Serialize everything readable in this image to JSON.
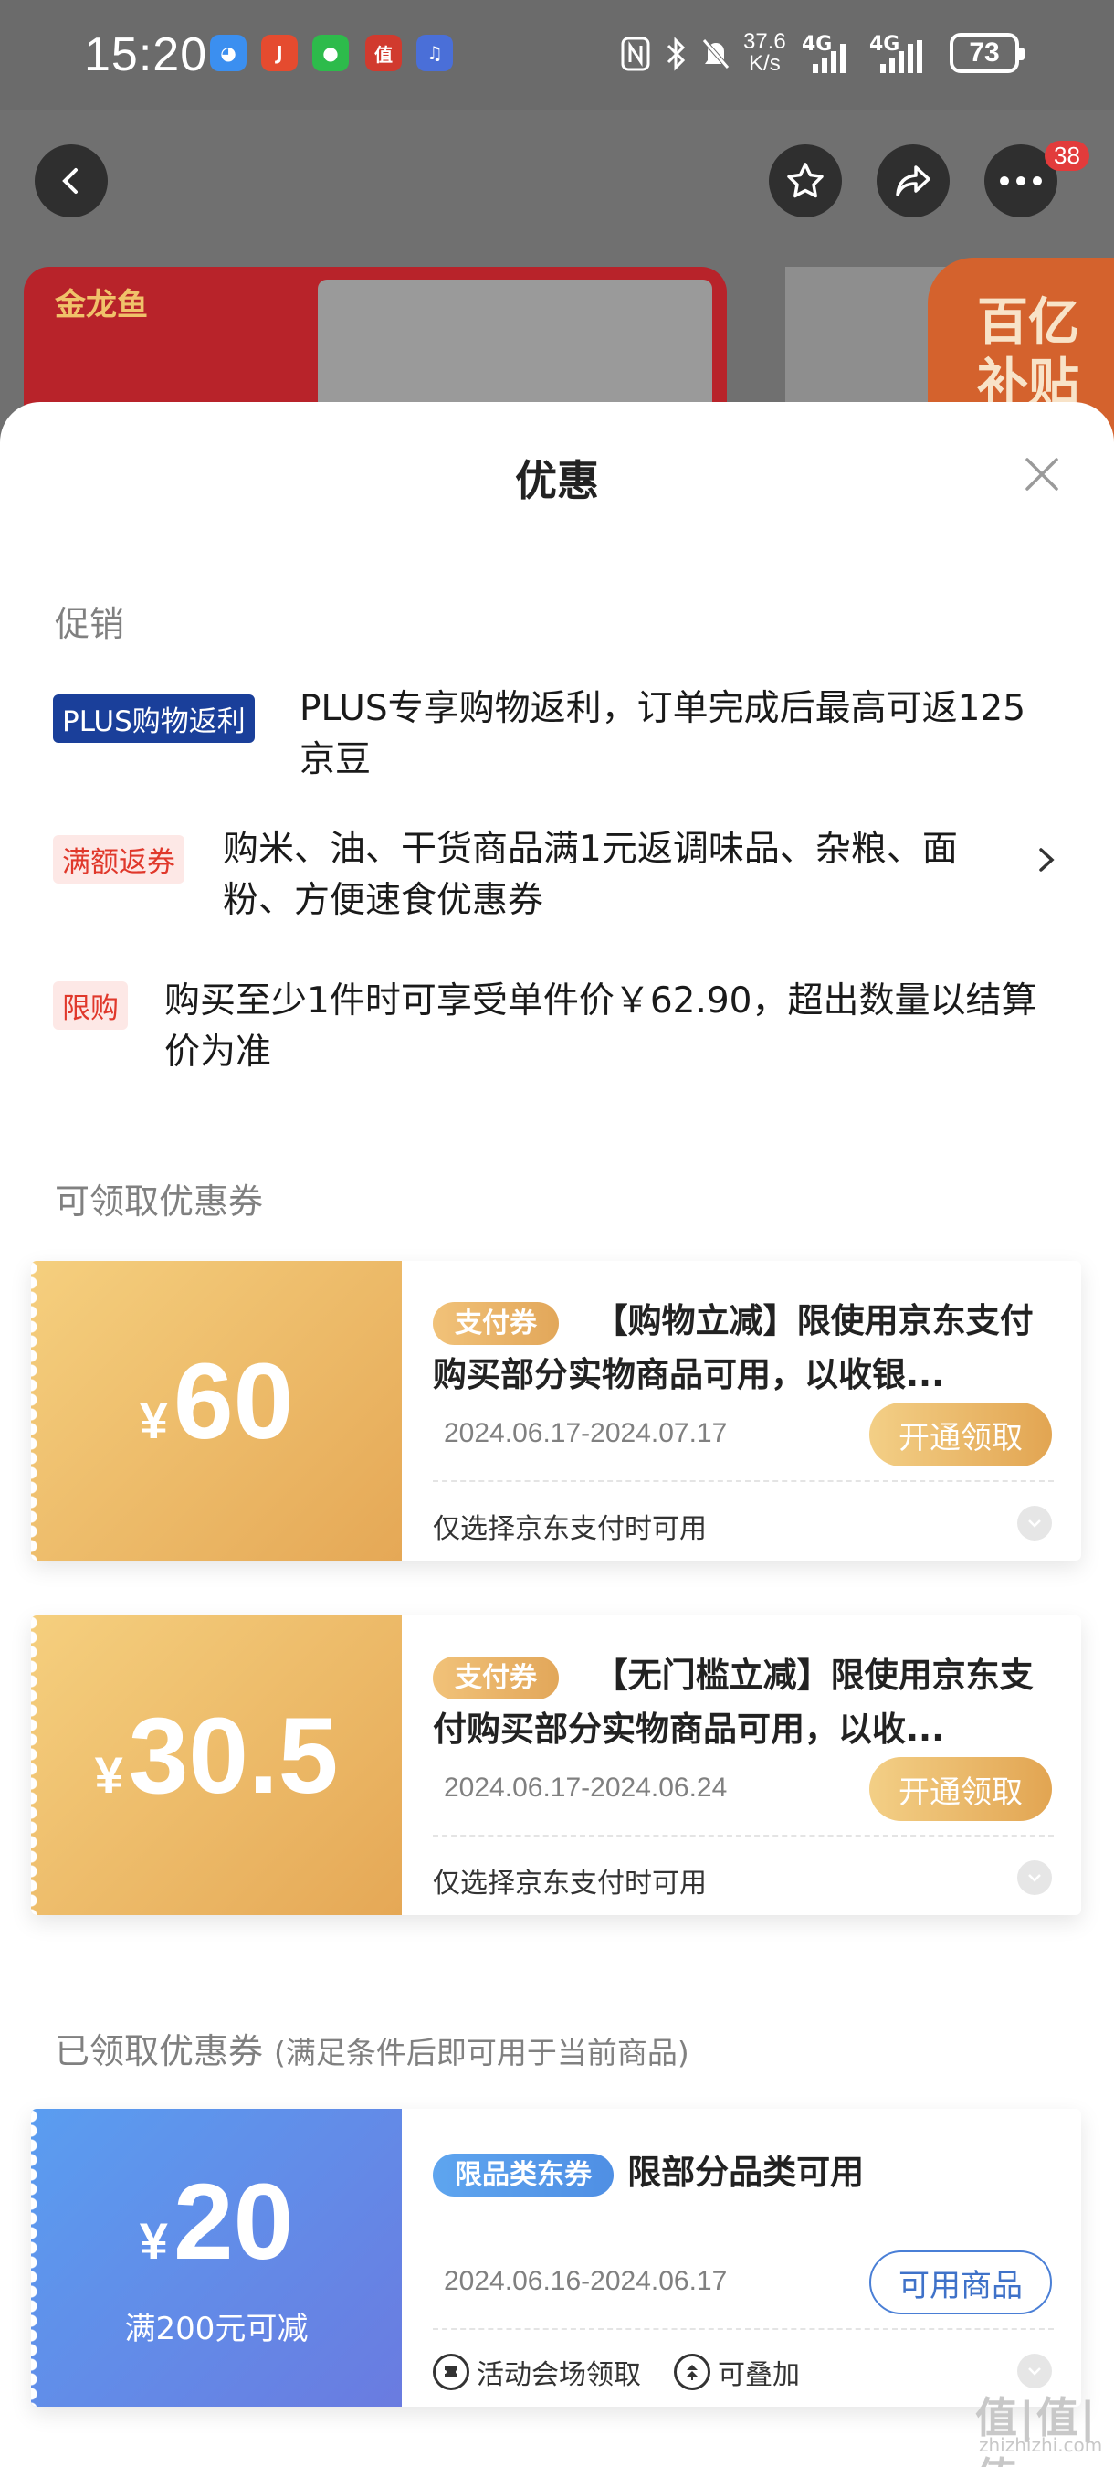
{
  "status_bar": {
    "time": "15:20",
    "net_speed": "37.6",
    "net_unit": "K/s",
    "signal1": "4G",
    "signal2": "4G",
    "battery": "73",
    "apps": [
      "qq-app-icon",
      "jd-app-icon",
      "wechat-app-icon",
      "smzdm-app-icon",
      "music-app-icon"
    ]
  },
  "banner": {
    "brand": "金龙鱼",
    "badge_line1": "百亿",
    "badge_line2": "补贴",
    "badge_count": "38"
  },
  "sheet": {
    "title": "优惠"
  },
  "promotions": {
    "heading": "促销",
    "items": [
      {
        "tag": "PLUS购物返利",
        "text": "PLUS专享购物返利，订单完成后最高可返125京豆"
      },
      {
        "tag": "满额返券",
        "text": "购米、油、干货商品满1元返调味品、杂粮、面粉、方便速食优惠券"
      },
      {
        "tag": "限购",
        "text": "购买至少1件时可享受单件价￥62.90，超出数量以结算价为准"
      }
    ]
  },
  "available_coupons": {
    "heading": "可领取优惠券",
    "items": [
      {
        "currency": "¥",
        "amount": "60",
        "tag": "支付券",
        "title": "【购物立减】限使用京东支付购买部分实物商品可用，以收银...",
        "date": "2024.06.17-2024.07.17",
        "button": "开通领取",
        "note": "仅选择京东支付时可用"
      },
      {
        "currency": "¥",
        "amount": "30.5",
        "tag": "支付券",
        "title": "【无门槛立减】限使用京东支付购买部分实物商品可用，以收...",
        "date": "2024.06.17-2024.06.24",
        "button": "开通领取",
        "note": "仅选择京东支付时可用"
      }
    ]
  },
  "claimed_coupons": {
    "heading": "已领取优惠券",
    "subheading": "(满足条件后即可用于当前商品)",
    "items": [
      {
        "currency": "¥",
        "amount": "20",
        "condition": "满200元可减",
        "tag": "限品类东券",
        "title": "限部分品类可用",
        "date": "2024.06.16-2024.06.17",
        "button": "可用商品",
        "note1": "活动会场领取",
        "note2": "可叠加"
      }
    ]
  },
  "watermark": {
    "main": "值|值|值",
    "sub": "zhizhizhi.com"
  },
  "colors": {
    "plus_tag_bg": "#1a3f9a",
    "red_tag_bg": "#fde8e6",
    "red_tag_text": "#e0382b",
    "gold": "#e5a856",
    "blue": "#5a9df0"
  }
}
